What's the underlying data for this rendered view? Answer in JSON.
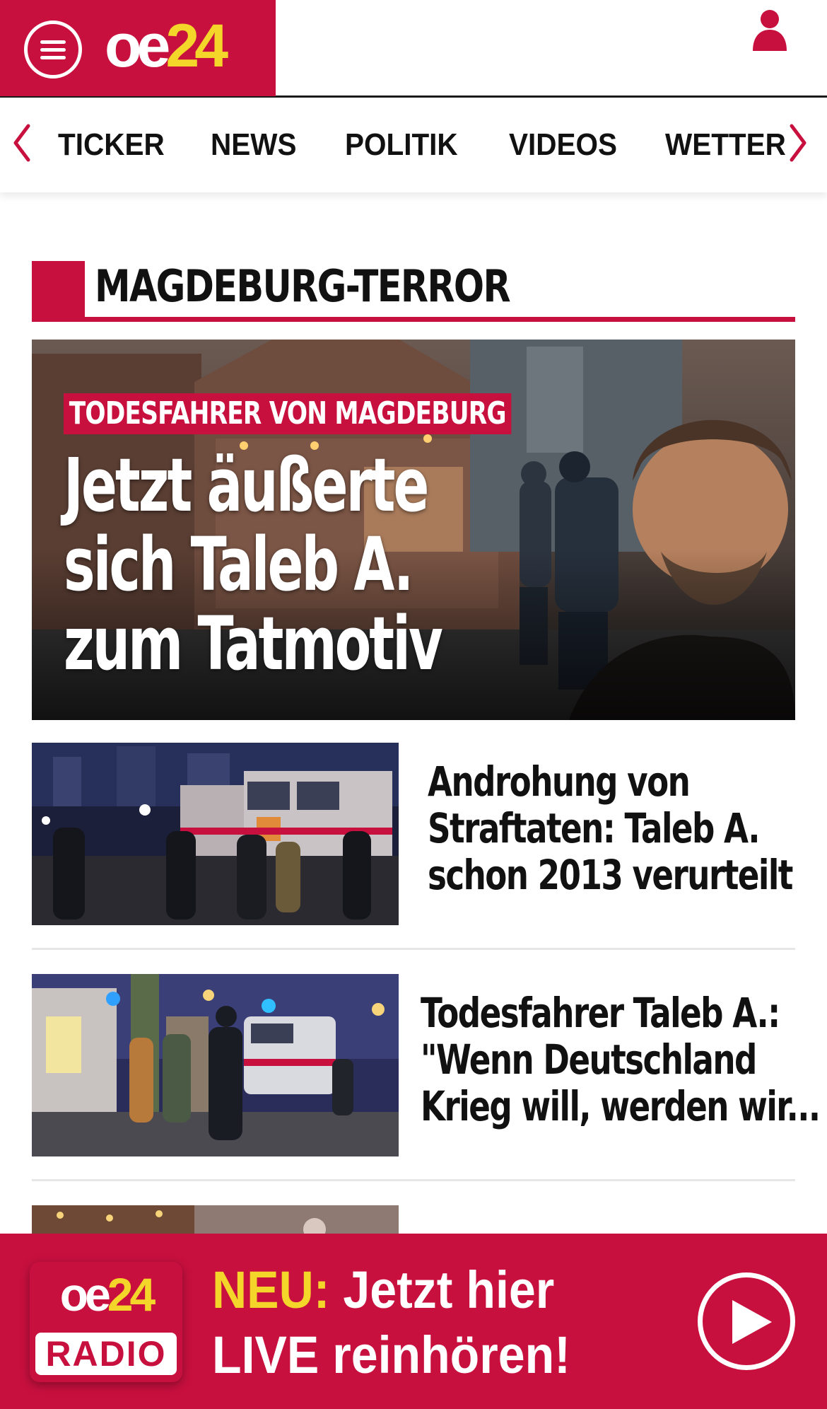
{
  "header": {
    "logo": {
      "oe": "oe",
      "num": "24"
    },
    "menu_icon": "hamburger-menu-icon",
    "user_icon": "user-icon",
    "brand_color": "#c8103e",
    "accent_color": "#f4d52a"
  },
  "nav": {
    "items": [
      "TICKER",
      "NEWS",
      "POLITIK",
      "VIDEOS",
      "WETTER"
    ],
    "prev_icon": "chevron-left-icon",
    "next_icon": "chevron-right-icon"
  },
  "section": {
    "title": "MAGDEBURG-TERROR"
  },
  "hero": {
    "kicker": "TODESFAHRER VON MAGDEBURG",
    "title_lines": [
      "Jetzt äußerte",
      "sich Taleb A.",
      "zum Tatmotiv"
    ]
  },
  "articles": [
    {
      "headline_lines": [
        "Androhung von",
        "Straftaten: Taleb A.",
        "schon 2013 verurteilt"
      ]
    },
    {
      "headline_lines": [
        "Todesfahrer Taleb A.:",
        "\"Wenn Deutschland",
        "Krieg will, werden wir..."
      ]
    }
  ],
  "radio_bar": {
    "logo": {
      "oe": "oe",
      "num": "24",
      "label": "RADIO"
    },
    "neu": "NEU:",
    "line1": "Jetzt hier",
    "line2": "LIVE reinhören!",
    "play_icon": "play-icon"
  }
}
